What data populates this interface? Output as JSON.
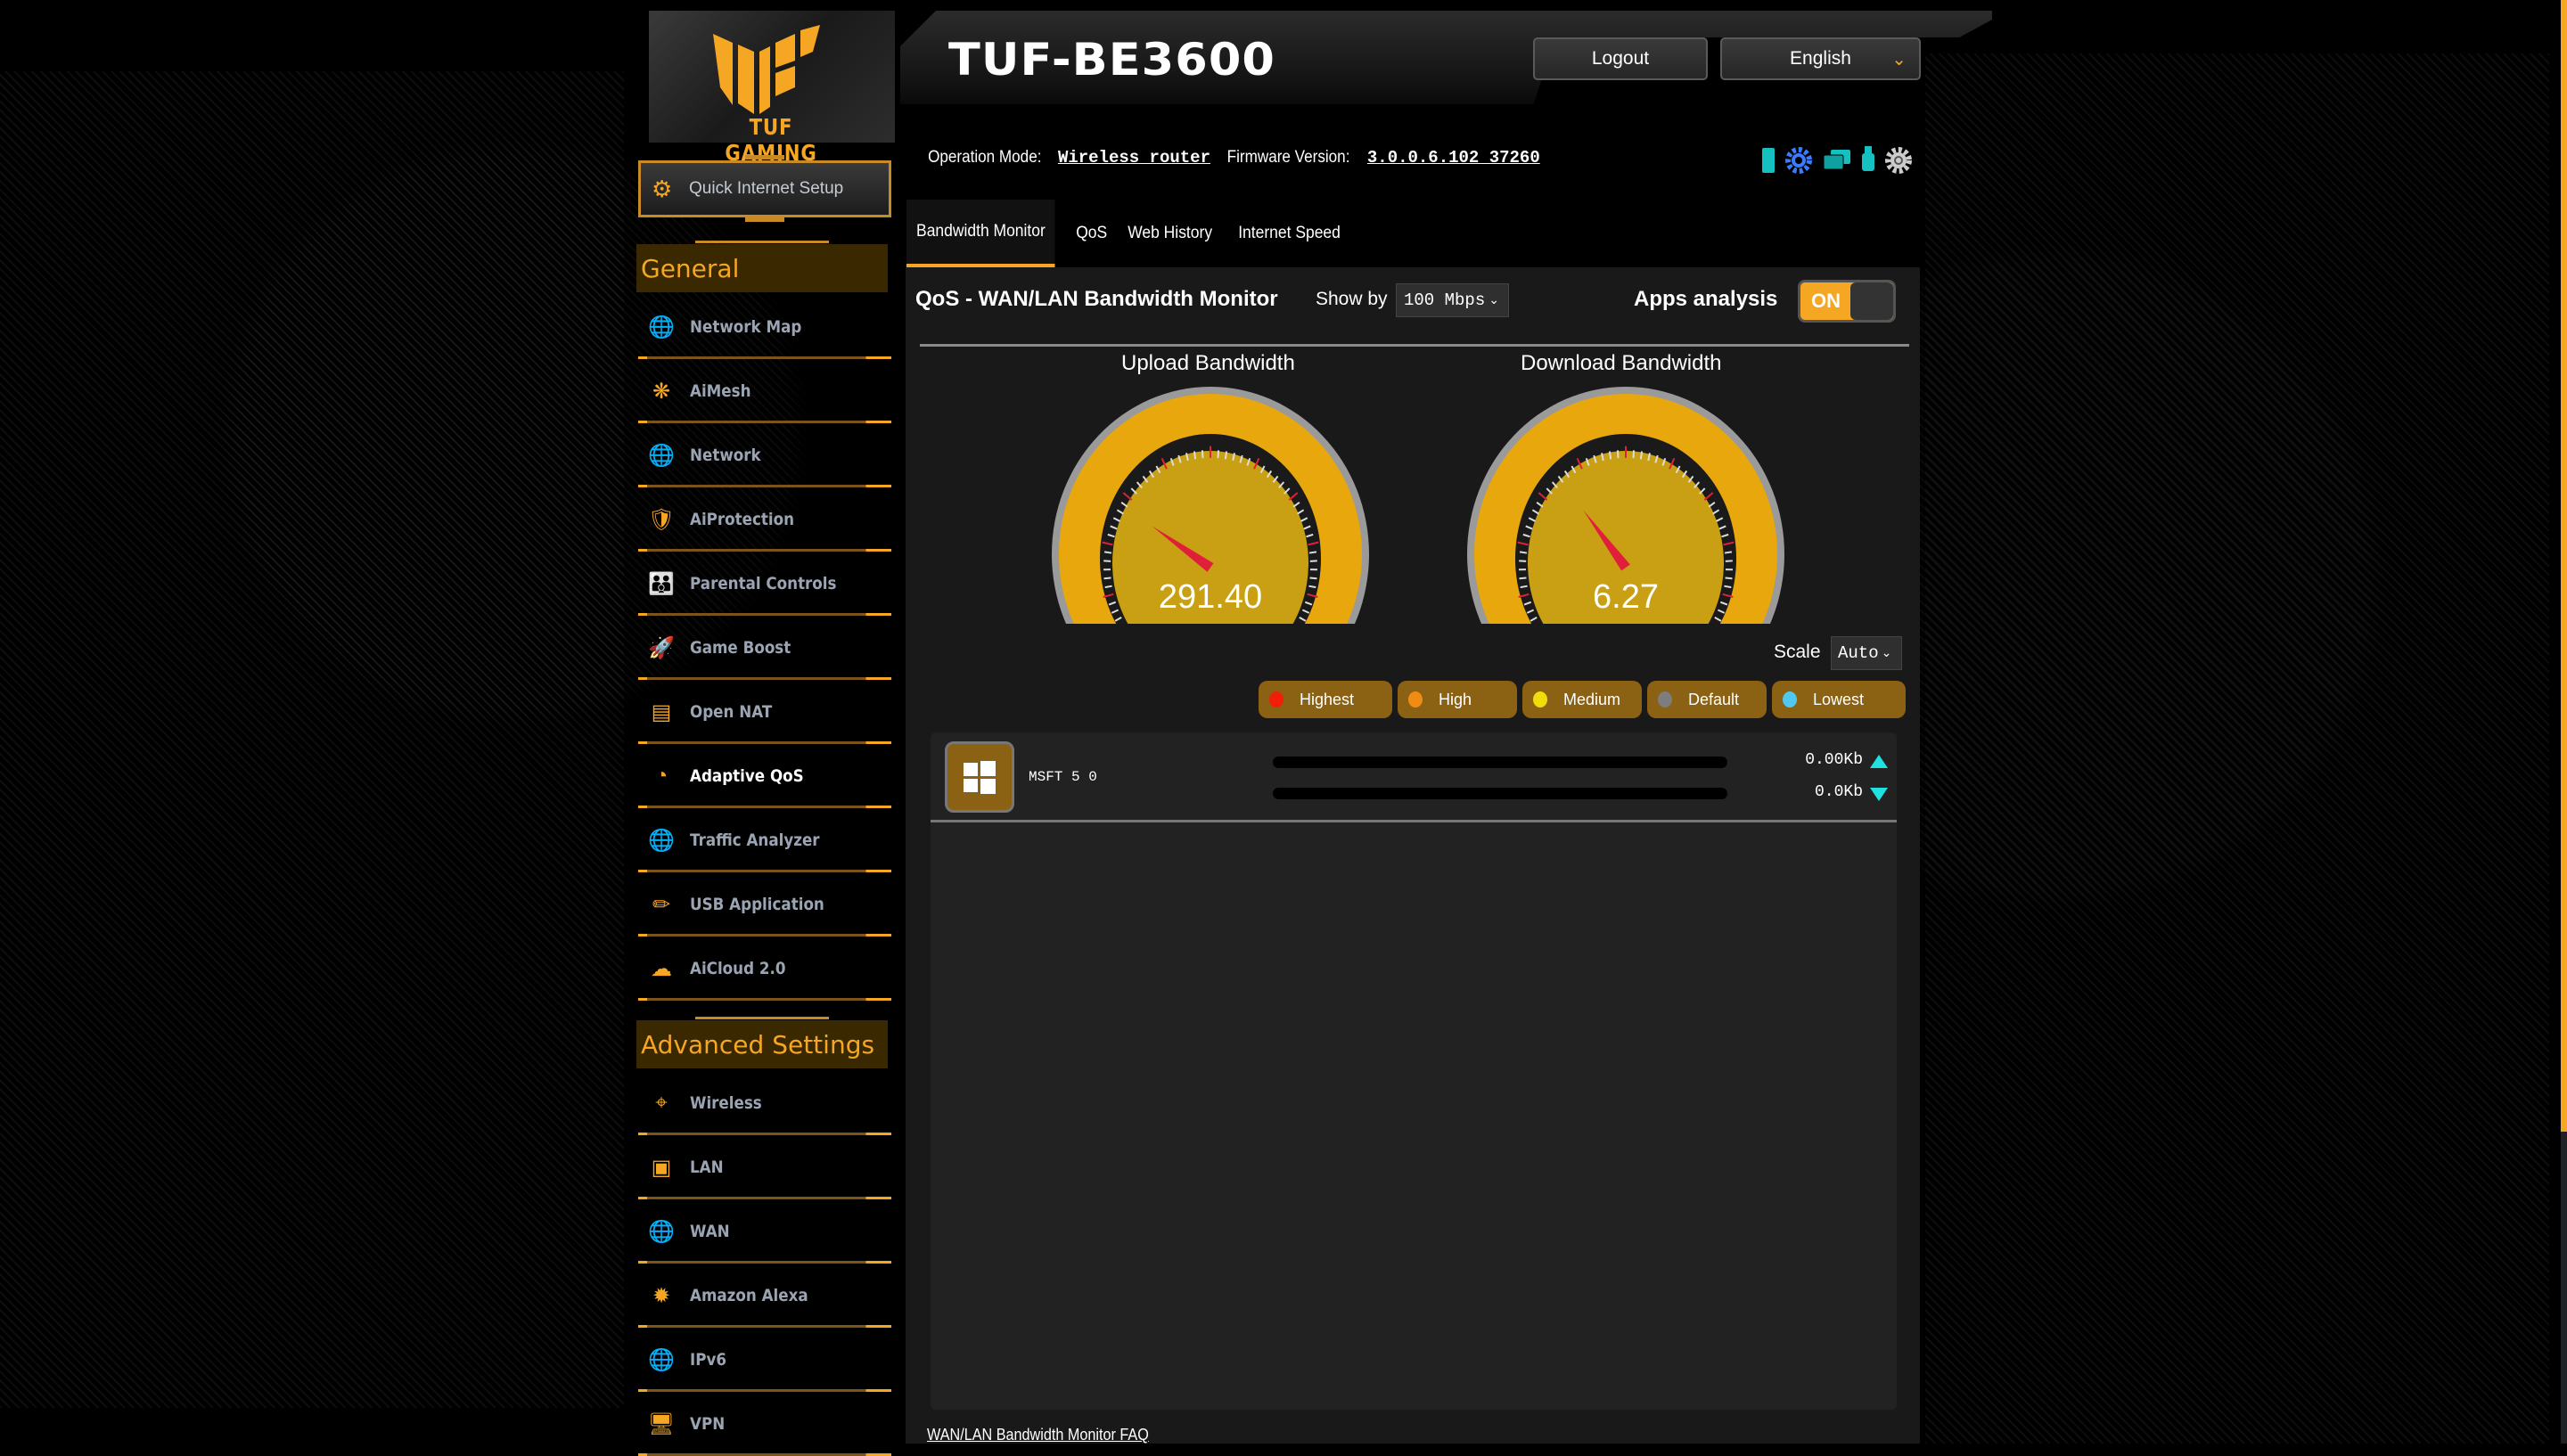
{
  "header": {
    "brand_text": "TUF GAMING",
    "model": "TUF-BE3600",
    "logout_label": "Logout",
    "language_selected": "English",
    "op_mode_label": "Operation Mode:",
    "op_mode_value": "Wireless router",
    "firmware_label": "Firmware Version:",
    "firmware_value": "3.0.0.6.102_37260",
    "status_icons": [
      "mobile-app-icon",
      "settings-gear-icon",
      "network-devices-icon",
      "usb-icon",
      "system-settings-icon"
    ]
  },
  "sidebar": {
    "quick_setup_label": "Quick Internet Setup",
    "general_title": "General",
    "general_items": [
      {
        "label": "Network Map",
        "icon": "globe-pin-icon"
      },
      {
        "label": "AiMesh",
        "icon": "mesh-icon"
      },
      {
        "label": "Network",
        "icon": "globe-users-icon"
      },
      {
        "label": "AiProtection",
        "icon": "shield-lock-icon"
      },
      {
        "label": "Parental Controls",
        "icon": "family-icon"
      },
      {
        "label": "Game Boost",
        "icon": "rocket-icon"
      },
      {
        "label": "Open NAT",
        "icon": "server-gamepad-icon"
      },
      {
        "label": "Adaptive QoS",
        "icon": "speedometer-icon",
        "active": true
      },
      {
        "label": "Traffic Analyzer",
        "icon": "globe-chart-icon"
      },
      {
        "label": "USB Application",
        "icon": "usb-drive-icon"
      },
      {
        "label": "AiCloud 2.0",
        "icon": "cloud-icon"
      }
    ],
    "advanced_title": "Advanced Settings",
    "advanced_items": [
      {
        "label": "Wireless",
        "icon": "wifi-icon"
      },
      {
        "label": "LAN",
        "icon": "ethernet-port-icon"
      },
      {
        "label": "WAN",
        "icon": "globe-icon"
      },
      {
        "label": "Amazon Alexa",
        "icon": "alexa-icon"
      },
      {
        "label": "IPv6",
        "icon": "ipv6-globe-icon"
      },
      {
        "label": "VPN",
        "icon": "vpn-monitor-icon"
      }
    ]
  },
  "tabs": [
    {
      "label": "Bandwidth Monitor",
      "active": true
    },
    {
      "label": "QoS"
    },
    {
      "label": "Web History"
    },
    {
      "label": "Internet Speed"
    }
  ],
  "monitor": {
    "title": "QoS - WAN/LAN Bandwidth Monitor",
    "show_by_label": "Show by",
    "show_by_value": "100  Mbps",
    "apps_analysis_label": "Apps analysis",
    "apps_analysis_state": "ON",
    "upload": {
      "label": "Upload Bandwidth",
      "value": "291.40",
      "needle_fraction": 0.29
    },
    "download": {
      "label": "Download Bandwidth",
      "value": "6.27",
      "needle_fraction": 0.36
    },
    "scale_label": "Scale",
    "scale_value": "Auto",
    "priorities": [
      {
        "label": "Highest",
        "color": "#f01e0a"
      },
      {
        "label": "High",
        "color": "#f08c14"
      },
      {
        "label": "Medium",
        "color": "#f0dc0a"
      },
      {
        "label": "Default",
        "color": "#7d7d7d"
      },
      {
        "label": "Lowest",
        "color": "#50c8f0"
      }
    ],
    "clients": [
      {
        "name": "MSFT 5 0",
        "icon": "windows-icon",
        "upload": "0.00Kb",
        "download": "0.0Kb"
      }
    ],
    "faq_link": "WAN/LAN Bandwidth Monitor FAQ"
  },
  "colors": {
    "accent": "#f5a623",
    "panel": "#191919",
    "priority_bg": "#8b6114",
    "arrow": "#20e0e0"
  }
}
